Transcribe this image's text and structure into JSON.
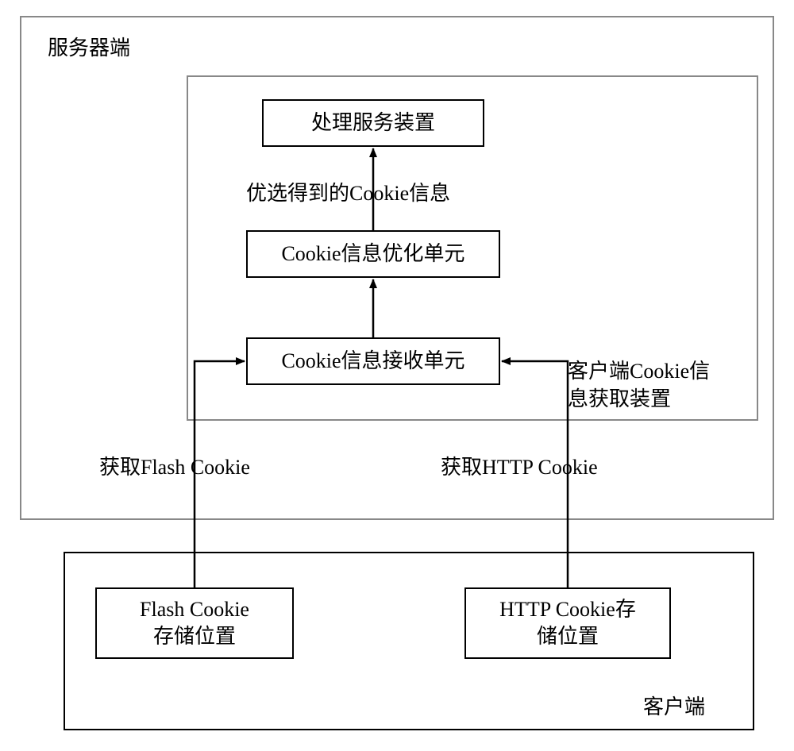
{
  "server": {
    "label": "服务器端"
  },
  "client_device": {
    "label": "客户端Cookie信\n息获取装置"
  },
  "processing_service": {
    "label": "处理服务装置"
  },
  "preferred_cookie_info": {
    "label": "优选得到的Cookie信息"
  },
  "cookie_optimization_unit": {
    "label": "Cookie信息优化单元"
  },
  "cookie_receive_unit": {
    "label": "Cookie信息接收单元"
  },
  "get_flash_cookie": {
    "label": "获取Flash Cookie"
  },
  "get_http_cookie": {
    "label": "获取HTTP Cookie"
  },
  "flash_cookie_storage": {
    "label": "Flash Cookie\n存储位置"
  },
  "http_cookie_storage": {
    "label": "HTTP Cookie存\n储位置"
  },
  "client": {
    "label": "客户端"
  }
}
